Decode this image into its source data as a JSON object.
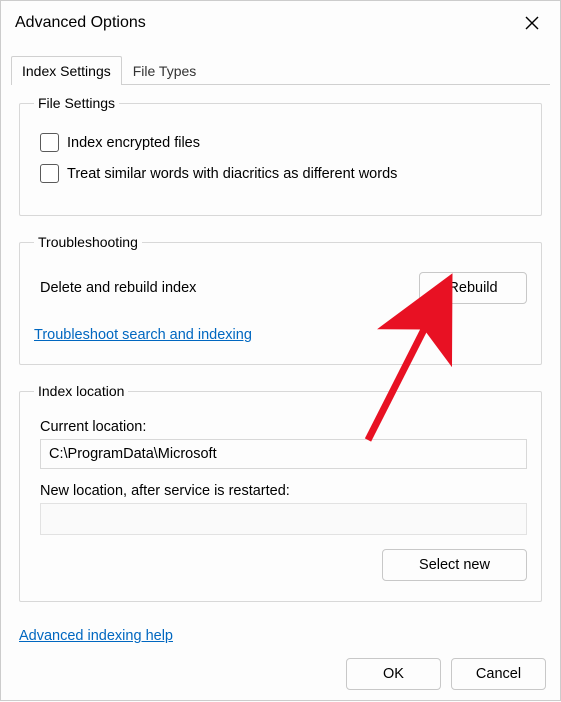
{
  "window": {
    "title": "Advanced Options"
  },
  "tabs": {
    "index_settings": "Index Settings",
    "file_types": "File Types"
  },
  "file_settings": {
    "legend": "File Settings",
    "encrypted_label": "Index encrypted files",
    "diacritics_label": "Treat similar words with diacritics as different words"
  },
  "troubleshooting": {
    "legend": "Troubleshooting",
    "delete_rebuild": "Delete and rebuild index",
    "rebuild_button": "Rebuild",
    "troubleshoot_link": "Troubleshoot search and indexing"
  },
  "index_location": {
    "legend": "Index location",
    "current_label": "Current location:",
    "current_value": "C:\\ProgramData\\Microsoft",
    "new_label": "New location, after service is restarted:",
    "select_new_button": "Select new"
  },
  "help_link": "Advanced indexing help",
  "buttons": {
    "ok": "OK",
    "cancel": "Cancel"
  }
}
